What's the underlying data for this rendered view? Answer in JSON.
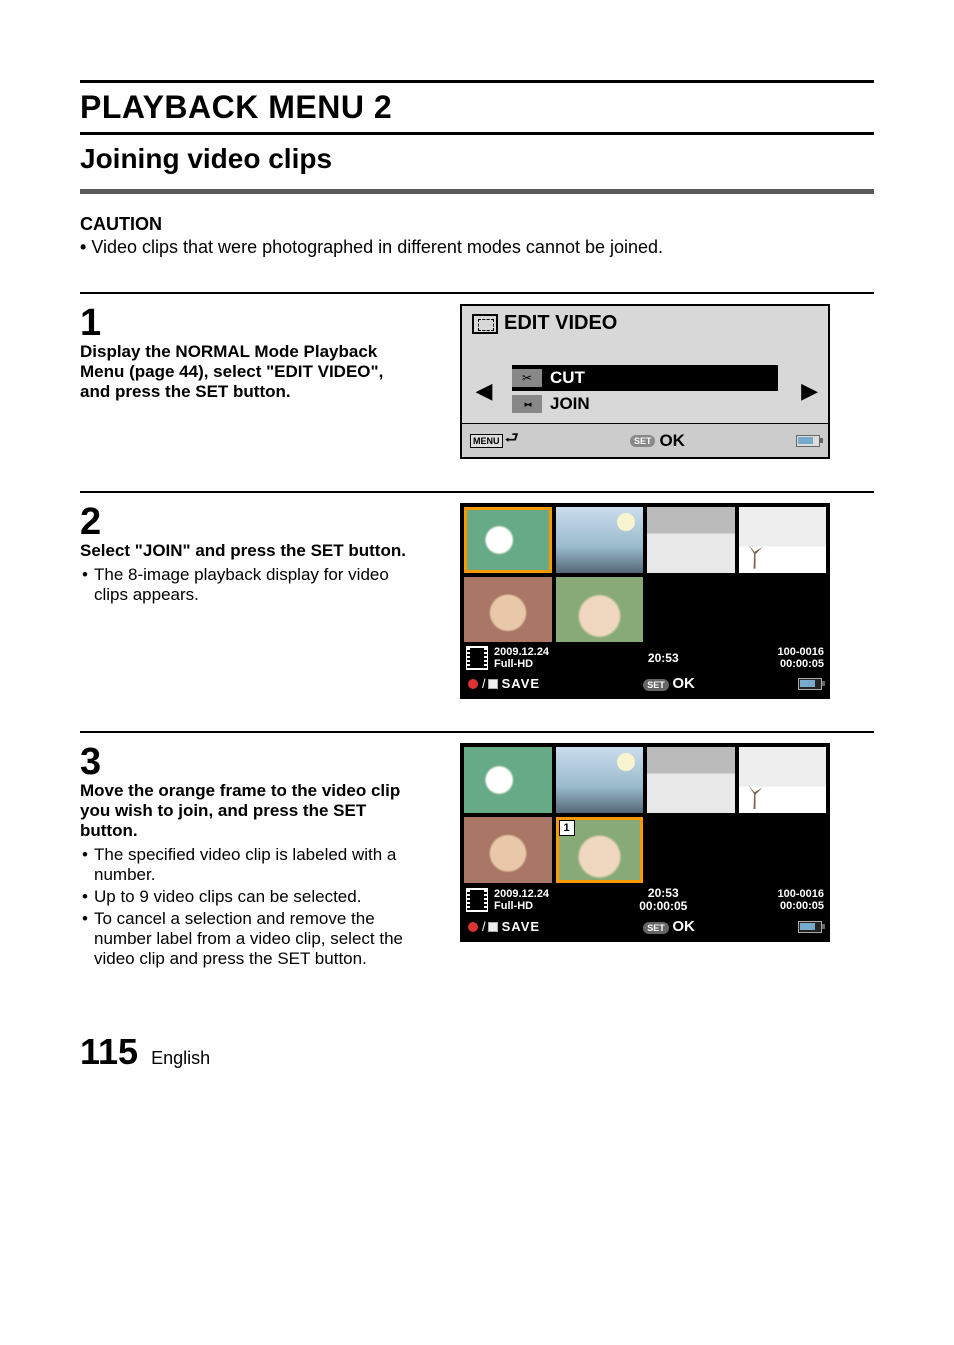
{
  "chapterTitle": "PLAYBACK MENU 2",
  "sectionTitle": "Joining video clips",
  "cautionHeading": "CAUTION",
  "cautionItems": [
    "Video clips that were photographed in different modes cannot be joined."
  ],
  "steps": [
    {
      "num": "1",
      "title": "Display the NORMAL Mode Playback Menu (page 44), select \"EDIT VIDEO\", and press the SET button.",
      "bullets": []
    },
    {
      "num": "2",
      "title": "Select \"JOIN\" and press the SET button.",
      "bullets": [
        "The 8-image playback display for video clips appears."
      ]
    },
    {
      "num": "3",
      "title": "Move the orange frame to the video clip you wish to join, and press the SET button.",
      "bullets": [
        "The specified video clip is labeled with a number.",
        "Up to 9 video clips can be selected.",
        "To cancel a selection and remove the number label from a video clip, select the video clip and press the SET button."
      ]
    }
  ],
  "screen1": {
    "title": "EDIT VIDEO",
    "options": [
      {
        "label": "CUT",
        "selected": true
      },
      {
        "label": "JOIN",
        "selected": false
      }
    ],
    "menuBtn": "MENU",
    "setLabel": "SET",
    "okLabel": "OK"
  },
  "screen2": {
    "date": "2009.12.24",
    "mode": "Full-HD",
    "time": "20:53",
    "fileNo": "100-0016",
    "duration": "00:00:05",
    "saveLabel": "SAVE",
    "setLabel": "SET",
    "okLabel": "OK",
    "midSecond": ""
  },
  "screen3": {
    "date": "2009.12.24",
    "mode": "Full-HD",
    "time": "20:53",
    "midSecond": "00:00:05",
    "fileNo": "100-0016",
    "duration": "00:00:05",
    "saveLabel": "SAVE",
    "setLabel": "SET",
    "okLabel": "OK",
    "badge": "1"
  },
  "footer": {
    "pageNum": "115",
    "lang": "English"
  }
}
